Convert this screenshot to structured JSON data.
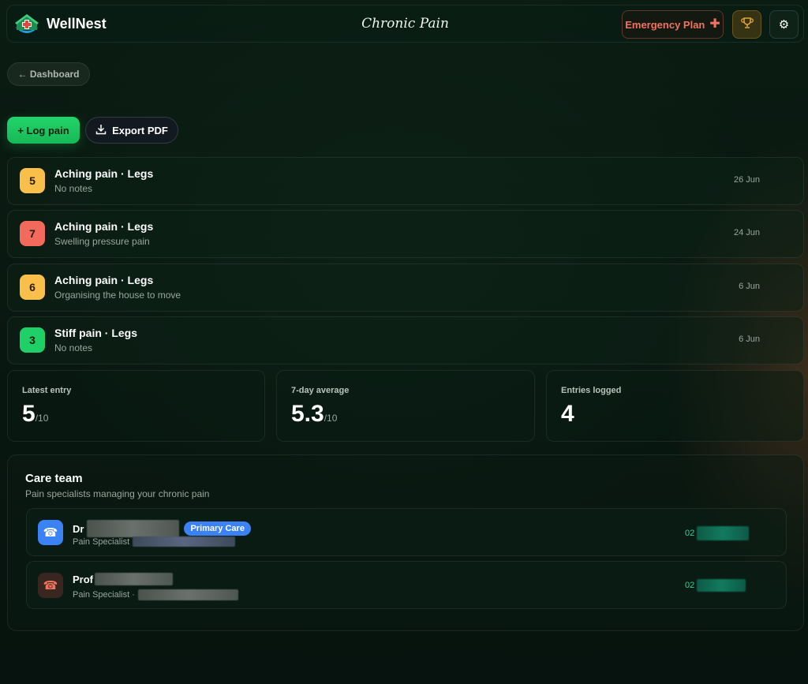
{
  "header": {
    "brand_name": "WellNest",
    "page_title": "Chronic Pain",
    "emergency_label": "Emergency Plan",
    "colors": {
      "accent": "#22d36a",
      "emergency": "#f0735f"
    },
    "icons": [
      "wellnest-logo-icon",
      "plus-cross-icon",
      "trophy-icon",
      "gear-icon"
    ]
  },
  "nav": {
    "back_label": "← Dashboard"
  },
  "actions": {
    "log_label": "+ Log pain",
    "export_label": "Export PDF"
  },
  "entries": [
    {
      "score": "5",
      "title": "Aching pain · Legs",
      "note": "No notes",
      "date": "26 Jun",
      "color": "#f9bf4b"
    },
    {
      "score": "7",
      "title": "Aching pain · Legs",
      "note": "Swelling pressure pain",
      "date": "24 Jun",
      "color": "#f26a5b"
    },
    {
      "score": "6",
      "title": "Aching pain · Legs",
      "note": "Organising the house to move",
      "date": "6 Jun",
      "color": "#f9bf4b"
    },
    {
      "score": "3",
      "title": "Stiff pain · Legs",
      "note": "No notes",
      "date": "6 Jun",
      "color": "#1fd068"
    }
  ],
  "stats": {
    "latest": {
      "label": "Latest entry",
      "value": "5",
      "unit": "/10"
    },
    "average": {
      "label": "7-day average",
      "value": "5.3",
      "unit": "/10"
    },
    "count": {
      "label": "Entries logged",
      "value": "4"
    }
  },
  "care_team": {
    "title": "Care team",
    "subtitle": "Pain specialists managing your chronic pain",
    "contacts": [
      {
        "prefix": "Dr",
        "badge": "Primary Care",
        "role": "Pain Specialist",
        "phone_prefix": "02"
      },
      {
        "prefix": "Prof",
        "role": "Pain Specialist ·",
        "phone_prefix": "02"
      }
    ]
  }
}
